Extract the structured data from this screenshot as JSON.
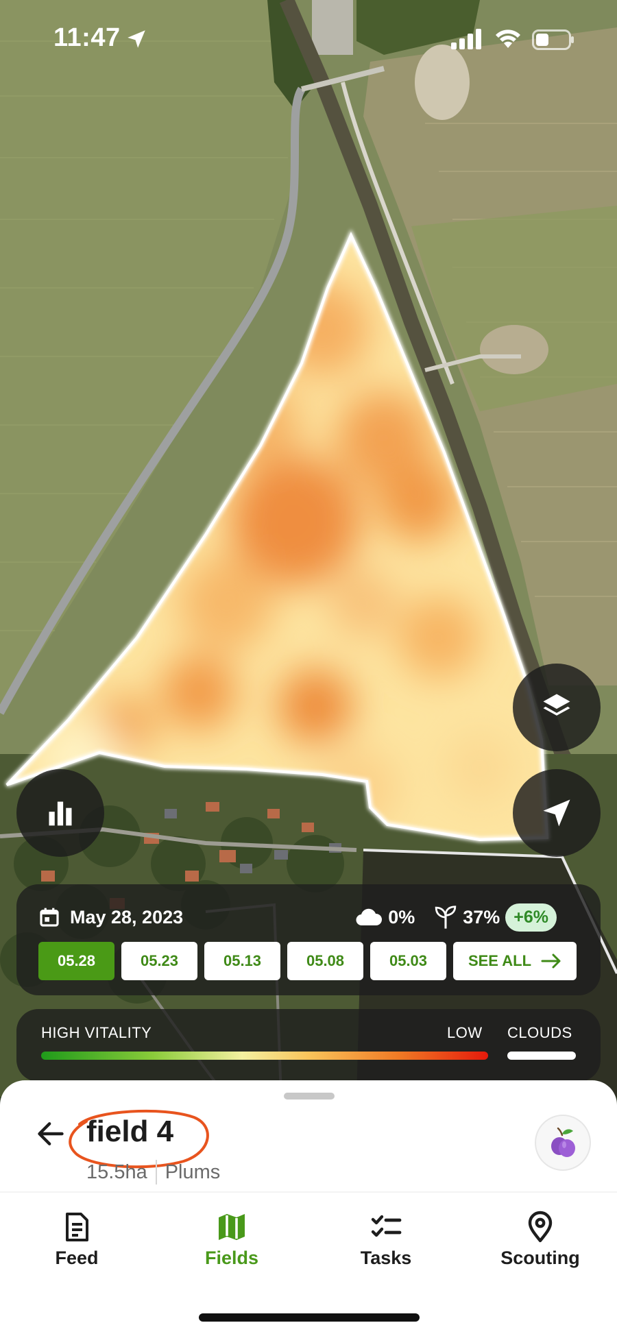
{
  "status_bar": {
    "time": "11:47"
  },
  "map": {
    "ndvi_colors": [
      "#fde9a8",
      "#f9c86c",
      "#f29a45",
      "#e8762e"
    ],
    "field_outline_color": "#ffffff"
  },
  "map_controls": {
    "layers_icon": "layers-icon",
    "locate_icon": "location-arrow-icon",
    "stats_icon": "bar-chart-icon"
  },
  "imagery": {
    "date_label": "May 28, 2023",
    "cloud_cover": "0%",
    "vegetation": "37%",
    "vegetation_delta": "+6%",
    "dates": [
      {
        "label": "05.28",
        "selected": true
      },
      {
        "label": "05.23",
        "selected": false
      },
      {
        "label": "05.13",
        "selected": false
      },
      {
        "label": "05.08",
        "selected": false
      },
      {
        "label": "05.03",
        "selected": false
      }
    ],
    "see_all_label": "SEE ALL"
  },
  "legend": {
    "high_label": "HIGH VITALITY",
    "low_label": "LOW",
    "clouds_label": "CLOUDS"
  },
  "field": {
    "name": "field 4",
    "area": "15.5ha",
    "crop": "Plums",
    "crop_icon": "plum-icon"
  },
  "tabs": {
    "feed": "Feed",
    "fields": "Fields",
    "tasks": "Tasks",
    "scouting": "Scouting",
    "active": "fields"
  },
  "colors": {
    "accent_green": "#49991a",
    "annotation_circle": "#e8541e"
  }
}
